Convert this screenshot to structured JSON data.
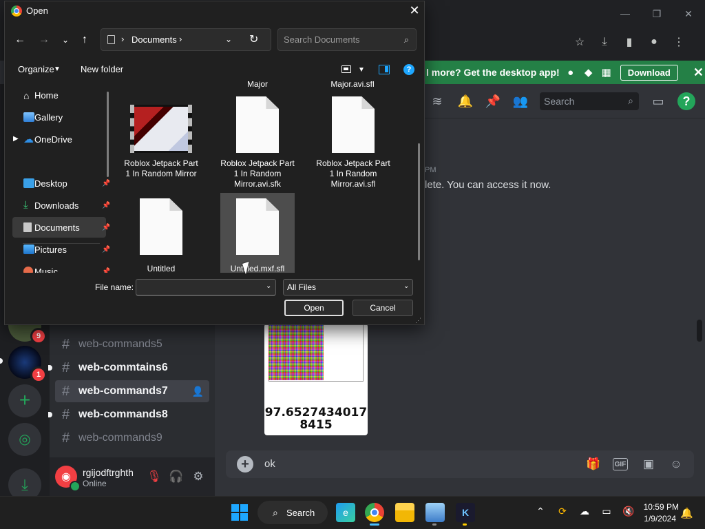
{
  "browser": {
    "controls": {
      "minimize": "—",
      "maximize": "❐",
      "close": "✕"
    },
    "toolbar_icons": [
      "star-icon",
      "download-icon",
      "sidebar-icon",
      "profile-icon",
      "menu-icon"
    ]
  },
  "promo": {
    "text": "l more? Get the desktop app!",
    "download_label": "Download",
    "close": "✕",
    "color": "#248046"
  },
  "servers": [
    {
      "badge": "9"
    },
    {
      "badge": "1"
    }
  ],
  "channels": [
    {
      "name": "web-commands5",
      "state": "muted"
    },
    {
      "name": "web-commtains6",
      "state": "unread"
    },
    {
      "name": "web-commands7",
      "state": "active"
    },
    {
      "name": "web-commands8",
      "state": "unread"
    },
    {
      "name": "web-commands9",
      "state": "muted"
    }
  ],
  "user": {
    "name": "rgijodftrghth",
    "status": "Online"
  },
  "chat": {
    "search_placeholder": "Search",
    "partial_timestamp": "PM",
    "partial_message": "lete. You can access it now.",
    "image_number": "97.65274340178415",
    "input_text": "ok"
  },
  "dialog": {
    "title": "Open",
    "close": "✕",
    "address": {
      "folder": "Documents",
      "sep": "›"
    },
    "search_placeholder": "Search Documents",
    "organize_label": "Organize",
    "new_folder_label": "New folder",
    "help": "?",
    "nav_items": [
      {
        "label": "Home",
        "icon": "home-icon"
      },
      {
        "label": "Gallery",
        "icon": "gallery-icon"
      },
      {
        "label": "OneDrive",
        "icon": "cloud-icon"
      },
      {
        "label": "Desktop",
        "icon": "desktop-icon"
      },
      {
        "label": "Downloads",
        "icon": "download-icon"
      },
      {
        "label": "Documents",
        "icon": "document-icon",
        "selected": true
      },
      {
        "label": "Pictures",
        "icon": "pictures-icon"
      },
      {
        "label": "Music",
        "icon": "music-icon"
      }
    ],
    "partial_files": [
      "Major",
      "Major.avi.sfl"
    ],
    "files": [
      {
        "name": "Roblox Jetpack Part 1 In Random Mirror",
        "type": "video"
      },
      {
        "name": "Roblox Jetpack Part 1 In Random Mirror.avi.sfk",
        "type": "doc"
      },
      {
        "name": "Roblox Jetpack Part 1 In Random Mirror.avi.sfl",
        "type": "doc"
      },
      {
        "name": "Untitled",
        "type": "doc"
      },
      {
        "name": "Untitled.mxf.sfl",
        "type": "doc",
        "selected": true
      }
    ],
    "file_name_label": "File name:",
    "file_name_value": "",
    "filter_value": "All Files",
    "open_label": "Open",
    "cancel_label": "Cancel"
  },
  "taskbar": {
    "search_label": "Search",
    "time": "10:59 PM",
    "date": "1/9/2024",
    "apps": [
      "edge-icon",
      "chrome-icon",
      "file-explorer-icon",
      "photos-icon",
      "app-icon"
    ]
  }
}
